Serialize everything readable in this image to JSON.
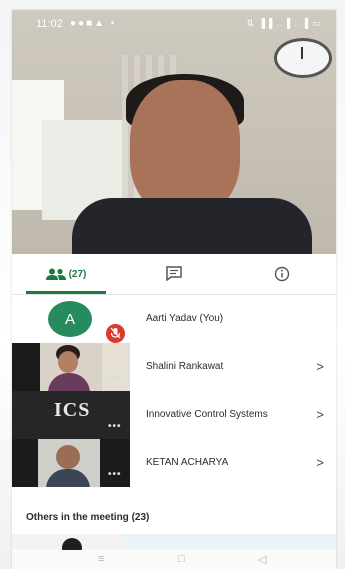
{
  "status_bar": {
    "time": "11:02",
    "notification_icons": "●●■▲ •",
    "signal_text": "⇅ ▐▐ ..▐ ..▐ ▭"
  },
  "tabs": [
    {
      "id": "people",
      "count": "(27)",
      "icon": "people-icon",
      "active": true
    },
    {
      "id": "chat",
      "icon": "chat-icon",
      "active": false
    },
    {
      "id": "info",
      "icon": "info-icon",
      "active": false
    }
  ],
  "participants": [
    {
      "name": "Aarti Yadav (You)",
      "avatar_letter": "A",
      "muted": true,
      "has_chevron": false
    },
    {
      "name": "Shalini Rankawat",
      "has_chevron": true,
      "indicator": "•••"
    },
    {
      "name": "Innovative Control Systems",
      "logo_text": "ICS",
      "has_chevron": true,
      "indicator": "•••"
    },
    {
      "name": "KETAN ACHARYA",
      "has_chevron": true,
      "indicator": "•••"
    }
  ],
  "chevron": ">",
  "others_section": {
    "title": "Others in the meeting (23)"
  },
  "nav": {
    "menu": "≡",
    "home": "□",
    "back": "◁"
  },
  "colors": {
    "accent_green": "#1e7a3c",
    "avatar_green": "#268c5f",
    "mute_red": "#d83a2e"
  }
}
